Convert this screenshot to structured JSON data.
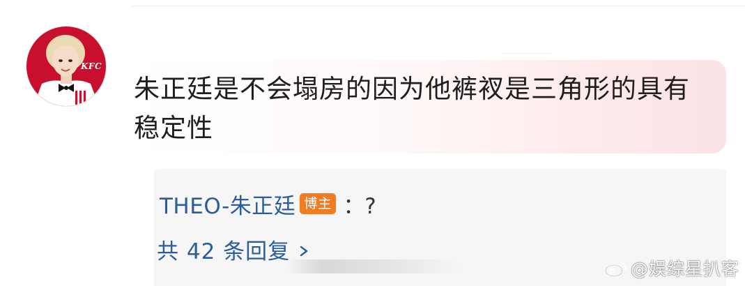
{
  "comment": {
    "avatar": {
      "icon": "kfc-avatar-icon",
      "logo_text": "KFC",
      "colors": {
        "background": "#c8102e",
        "logo_text": "#ffffff"
      }
    },
    "text": "朱正廷是不会塌房的因为他裤衩是三角形的具有稳定性"
  },
  "reply": {
    "user": "THEO-朱正廷",
    "badge": "博主",
    "text": "：?",
    "more_replies": "共 42 条回复",
    "chevron_icon": "chevron-right-icon"
  },
  "watermark": {
    "icon": "weibo-logo-icon",
    "text": "@娱综星扒客"
  },
  "colors": {
    "link": "#2a5c9e",
    "badge": "#f07d21",
    "bubble_tint": "#fce3e5",
    "reply_bg": "#f6f6f6"
  }
}
